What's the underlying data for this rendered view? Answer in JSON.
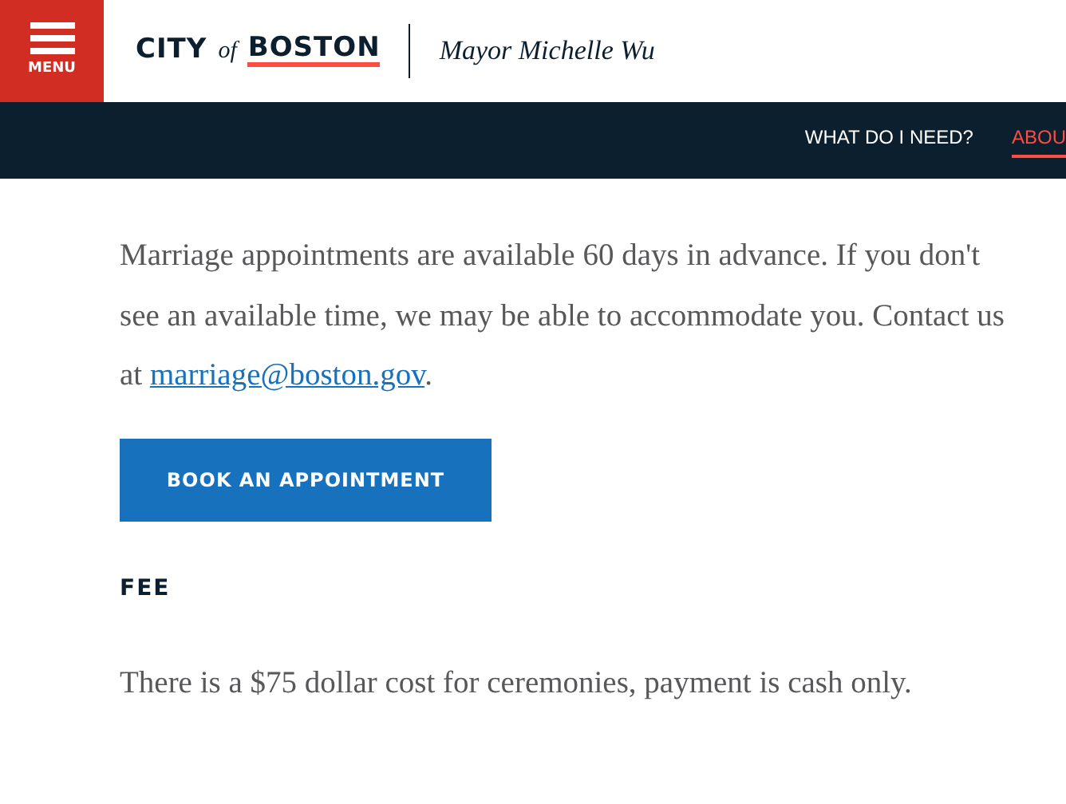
{
  "header": {
    "menu_label": "MENU",
    "logo": {
      "city": "CITY",
      "of": "of",
      "boston": "BOSTON"
    },
    "mayor": "Mayor Michelle Wu"
  },
  "nav": {
    "items": [
      {
        "label": "WHAT DO I NEED?",
        "selected": false
      },
      {
        "label": "ABOU",
        "selected": true
      }
    ]
  },
  "content": {
    "paragraph": "Marriage appointments are available 60 days in advance. If you don't see an available time, we may be able to accommodate you. Contact us at ",
    "email_link": "marriage@boston.gov",
    "paragraph_end": ".",
    "button": "BOOK AN APPOINTMENT",
    "fee_heading": "FEE",
    "fee_text": "There is a $75 dollar cost for ceremonies, payment is cash only."
  }
}
